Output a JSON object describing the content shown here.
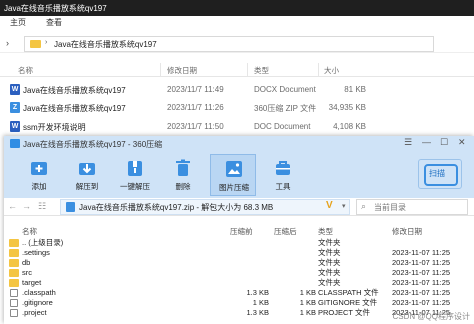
{
  "explorer": {
    "window_title": "Java在线音乐播放系统qv197",
    "menu": [
      "主页",
      "查看"
    ],
    "address": {
      "path": "Java在线音乐播放系统qv197"
    },
    "columns": {
      "name": "名称",
      "date": "修改日期",
      "type": "类型",
      "size": "大小"
    },
    "rows": [
      {
        "icon": "W",
        "icon_color": "#2b5fbf",
        "name": "Java在线音乐播放系统qv197",
        "date": "2023/11/7 11:49",
        "type": "DOCX Document",
        "size": "81 KB"
      },
      {
        "icon": "Z",
        "icon_color": "#3b8fe0",
        "name": "Java在线音乐播放系统qv197",
        "date": "2023/11/7 11:26",
        "type": "360压缩 ZIP 文件",
        "size": "34,935 KB"
      },
      {
        "icon": "W",
        "icon_color": "#2b5fbf",
        "name": "ssm开发环境说明",
        "date": "2023/11/7 11:50",
        "type": "DOC Document",
        "size": "4,108 KB"
      }
    ]
  },
  "zip_window": {
    "title": "Java在线音乐播放系统qv197 - 360压缩",
    "window_controls": [
      "☰",
      "—",
      "☐",
      "✕"
    ],
    "toolbar": [
      {
        "label": "添加",
        "icon": "add-icon"
      },
      {
        "label": "解压到",
        "icon": "extract-to-icon"
      },
      {
        "label": "一键解压",
        "icon": "one-click-extract-icon"
      },
      {
        "label": "删除",
        "icon": "delete-icon"
      },
      {
        "label": "图片压缩",
        "icon": "image-compress-icon"
      },
      {
        "label": "工具",
        "icon": "tools-icon"
      }
    ],
    "scan_label": "扫描",
    "nav": {
      "path": "Java在线音乐播放系统qv197.zip - 解包大小为 68.3 MB",
      "search_placeholder": "当前目录"
    },
    "columns": {
      "name": "名称",
      "size": "压缩前",
      "compressed": "压缩后",
      "type": "类型",
      "date": "修改日期"
    },
    "rows": [
      {
        "kind": "folder",
        "name": ".. (上级目录)",
        "size": "",
        "compressed": "",
        "type": "文件夹",
        "date": ""
      },
      {
        "kind": "folder",
        "name": ".settings",
        "size": "",
        "compressed": "",
        "type": "文件夹",
        "date": "2023-11-07 11:25"
      },
      {
        "kind": "folder",
        "name": "db",
        "size": "",
        "compressed": "",
        "type": "文件夹",
        "date": "2023-11-07 11:25"
      },
      {
        "kind": "folder",
        "name": "src",
        "size": "",
        "compressed": "",
        "type": "文件夹",
        "date": "2023-11-07 11:25"
      },
      {
        "kind": "folder",
        "name": "target",
        "size": "",
        "compressed": "",
        "type": "文件夹",
        "date": "2023-11-07 11:25"
      },
      {
        "kind": "file",
        "name": ".classpath",
        "size": "1.3 KB",
        "compressed": "1 KB",
        "type": "CLASSPATH 文件",
        "date": "2023-11-07 11:25"
      },
      {
        "kind": "file",
        "name": ".gitignore",
        "size": "1 KB",
        "compressed": "1 KB",
        "type": "GITIGNORE 文件",
        "date": "2023-11-07 11:25"
      },
      {
        "kind": "file",
        "name": ".project",
        "size": "1.3 KB",
        "compressed": "1 KB",
        "type": "PROJECT 文件",
        "date": "2023-11-07 11:25"
      }
    ]
  },
  "watermark": "CSDN @QQ程序设计"
}
